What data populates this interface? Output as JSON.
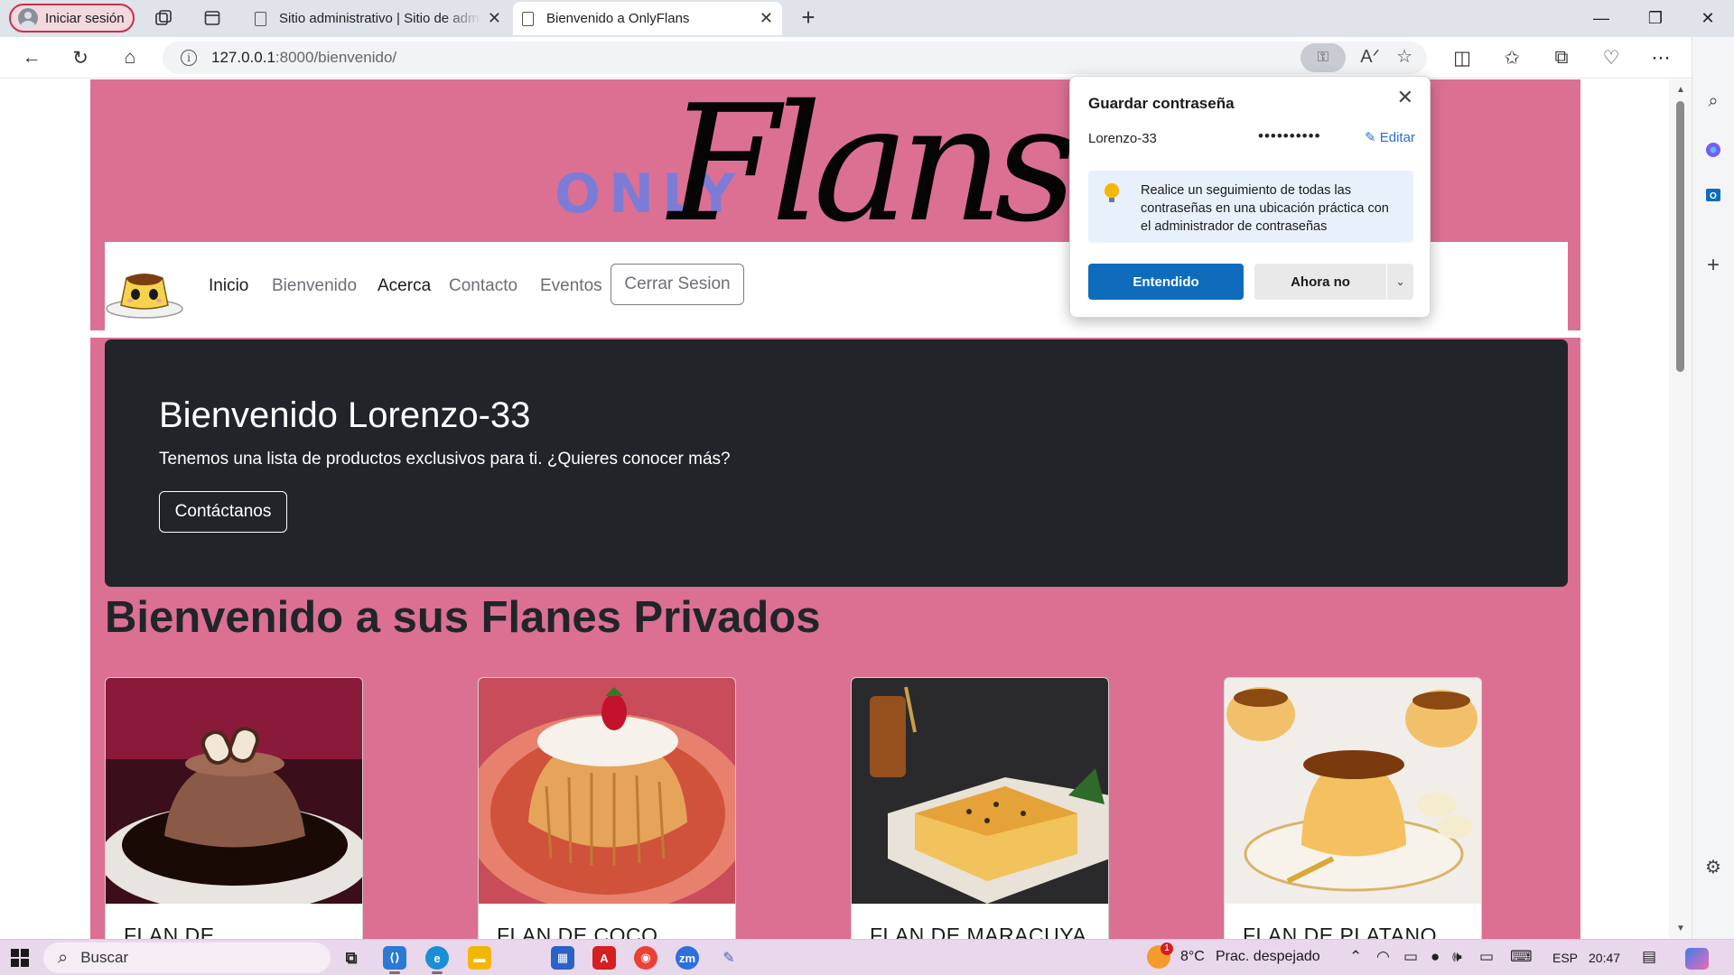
{
  "browser": {
    "profile_label": "Iniciar sesión",
    "tabs": [
      {
        "title": "Sitio administrativo | Sitio de administración de Django",
        "active": false
      },
      {
        "title": "Bienvenido a OnlyFlans",
        "active": true
      }
    ],
    "url_host": "127.0.0.1",
    "url_path": ":8000/bienvenido/"
  },
  "site": {
    "logo_only": "ONLY",
    "logo_flans": "Flans",
    "nav": {
      "links": [
        "Inicio",
        "Bienvenido",
        "Acerca",
        "Contacto",
        "Eventos"
      ],
      "logout_button": "Cerrar Sesion"
    },
    "hero": {
      "title": "Bienvenido Lorenzo-33",
      "text": "Tenemos una lista de productos exclusivos para ti. ¿Quieres conocer más?",
      "button": "Contáctanos"
    },
    "section_title": "Bienvenido a sus Flanes Privados",
    "cards": [
      {
        "title": "FLAN DE"
      },
      {
        "title": "FLAN DE COCO"
      },
      {
        "title": "FLAN DE MARACUYA"
      },
      {
        "title": "FLAN DE PLATANO"
      }
    ]
  },
  "password_popup": {
    "title": "Guardar contraseña",
    "username": "Lorenzo-33",
    "password_mask": "••••••••••",
    "edit_label": "Editar",
    "tip": "Realice un seguimiento de todas las contraseñas en una ubicación práctica con el administrador de contraseñas",
    "primary_button": "Entendido",
    "secondary_button": "Ahora no"
  },
  "taskbar": {
    "search_placeholder": "Buscar",
    "weather_temp": "8°C",
    "weather_desc": "Prac. despejado",
    "language": "ESP",
    "time": "20:47",
    "notification_count": "1"
  },
  "colors": {
    "site_background": "#db7093",
    "hero_background": "#212529",
    "logo_only": "#7c7cd6",
    "primary_button": "#0f6cbd",
    "profile_border": "#c4314b"
  }
}
